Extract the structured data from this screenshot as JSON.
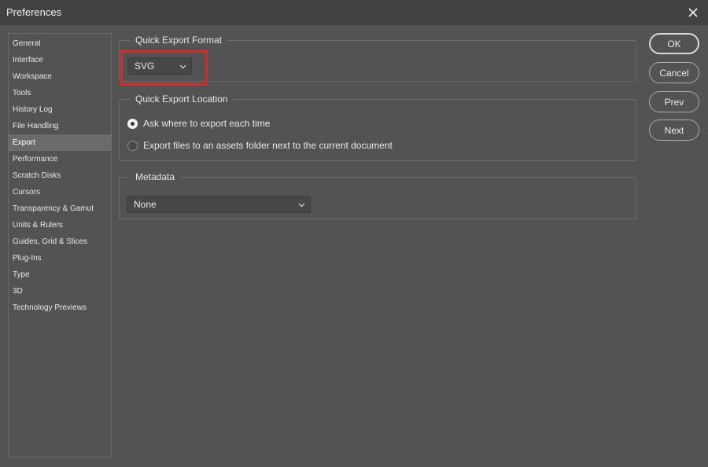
{
  "window": {
    "title": "Preferences"
  },
  "sidebar": {
    "items": [
      {
        "label": "General"
      },
      {
        "label": "Interface"
      },
      {
        "label": "Workspace"
      },
      {
        "label": "Tools"
      },
      {
        "label": "History Log"
      },
      {
        "label": "File Handling"
      },
      {
        "label": "Export",
        "active": true
      },
      {
        "label": "Performance"
      },
      {
        "label": "Scratch Disks"
      },
      {
        "label": "Cursors"
      },
      {
        "label": "Transparency & Gamut"
      },
      {
        "label": "Units & Rulers"
      },
      {
        "label": "Guides, Grid & Slices"
      },
      {
        "label": "Plug-Ins"
      },
      {
        "label": "Type"
      },
      {
        "label": "3D"
      },
      {
        "label": "Technology Previews"
      }
    ]
  },
  "quick_export_format": {
    "legend": "Quick Export Format",
    "selected": "SVG"
  },
  "quick_export_location": {
    "legend": "Quick Export Location",
    "options": [
      {
        "label": "Ask where to export each time",
        "checked": true
      },
      {
        "label": "Export files to an assets folder next to the current document",
        "checked": false
      }
    ]
  },
  "metadata": {
    "legend": "Metadata",
    "selected": "None"
  },
  "buttons": {
    "ok": "OK",
    "cancel": "Cancel",
    "prev": "Prev",
    "next": "Next"
  },
  "colors": {
    "background": "#535353",
    "titlebar": "#424242",
    "highlight": "#d62b2b"
  }
}
